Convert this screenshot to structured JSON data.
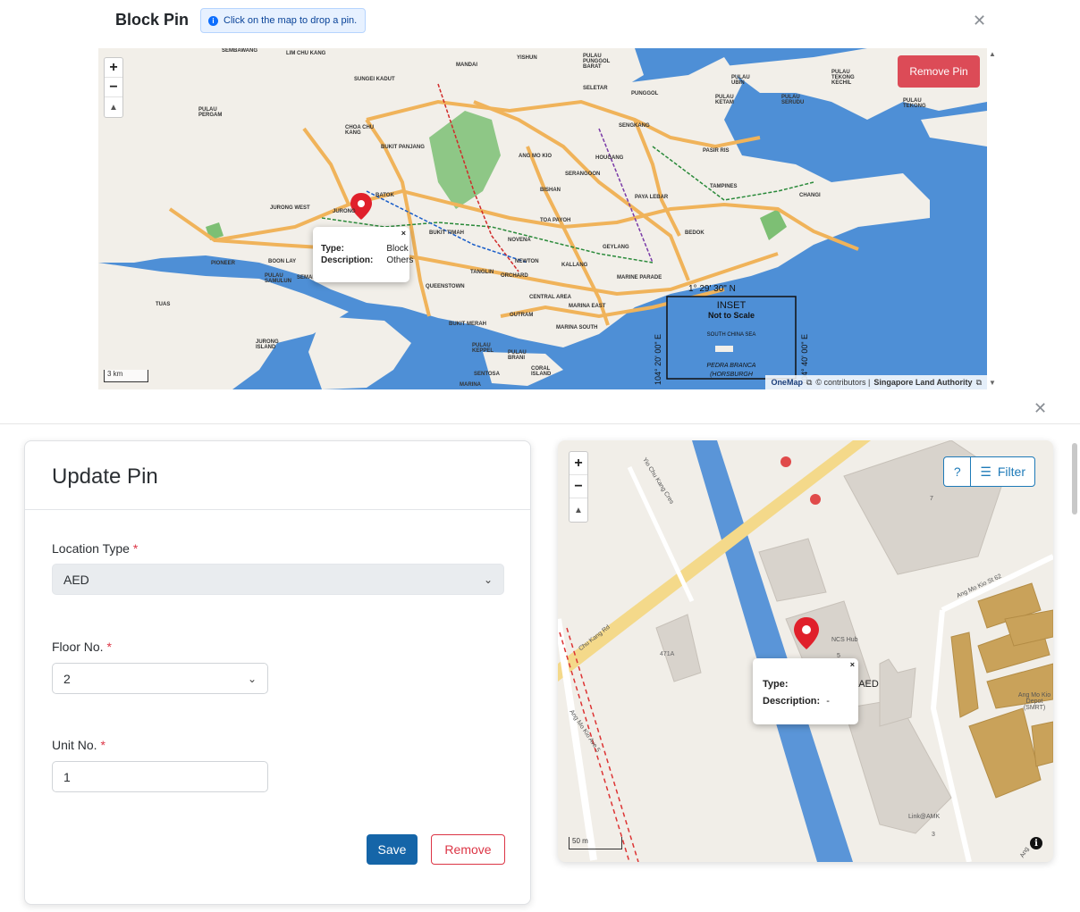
{
  "block_pin_modal": {
    "title": "Block Pin",
    "info_message": "Click on the map to drop a pin.",
    "remove_pin_label": "Remove Pin",
    "popup": {
      "type_label": "Type:",
      "type_value": "Block",
      "description_label": "Description:",
      "description_value": "Others"
    },
    "scale_label": "3 km",
    "attribution": {
      "brand": "OneMap",
      "contributors": "© contributors |",
      "authority": "Singapore Land Authority"
    },
    "inset": {
      "lat": "1° 29' 30\" N",
      "title": "INSET",
      "subtitle": "Not to Scale",
      "sea": "SOUTH CHINA SEA",
      "island": "PEDRA BRANCA",
      "island_sub": "(HORSBURGH",
      "lon_left": "104° 20' 00\" E",
      "lon_right": "104° 40' 00\" E"
    },
    "place_labels": [
      "SEMBAWANG",
      "LIM CHU KANG",
      "MANDAI",
      "YISHUN",
      "PULAU PUNGGOL BARAT",
      "SELETAR",
      "PUNGGOL",
      "PULAU UBIN",
      "PULAU TEKONG KECHIL",
      "PULAU TEKONG",
      "SUNGEI KADUT",
      "PULAU PERGAM",
      "CHOA CHU KANG",
      "BUKIT PANJANG",
      "SENGKANG",
      "PASIR RIS",
      "ANG MO KIO",
      "HOUGANG",
      "SERANGOON",
      "BISHAN",
      "PAYA LEBAR",
      "TAMPINES",
      "CHANGI",
      "JURONG WEST",
      "JURONG",
      "BATOK",
      "TOA PAYOH",
      "BUKIT TIMAH",
      "NOVENA",
      "GEYLANG",
      "BEDOK",
      "PIONEER",
      "BOON LAY",
      "NEWTON",
      "KALLANG",
      "TANGLIN",
      "ORCHARD",
      "MARINE PARADE",
      "QUEENSTOWN",
      "CENTRAL AREA",
      "TUAS",
      "MARINA EAST",
      "OUTRAM",
      "BUKIT MERAH",
      "MARINA SOUTH",
      "JURONG ISLAND",
      "PULAU KEPPEL",
      "PULAU BRANI",
      "SENTOSA",
      "CORAL ISLAND",
      "PULAU SAMULUN",
      "SEMAKAU",
      "PULAU KETAM",
      "PULAU SERUDU",
      "MARINA"
    ]
  },
  "update_pin": {
    "title": "Update Pin",
    "location_type": {
      "label": "Location Type",
      "value": "AED"
    },
    "floor_no": {
      "label": "Floor No.",
      "value": "2"
    },
    "unit_no": {
      "label": "Unit No.",
      "value": "1"
    },
    "required_marker": "*",
    "save_label": "Save",
    "remove_label": "Remove"
  },
  "detail_map": {
    "help_label": "?",
    "filter_label": "Filter",
    "popup": {
      "type_label": "Type:",
      "type_value": "AED",
      "description_label": "Description:",
      "description_value": "-"
    },
    "scale_label": "50 m",
    "labels": {
      "road1": "Yio Chu Kang Cres",
      "road2": "Chu Kang Rd",
      "road3": "Ang Mo Kio St 62",
      "road4": "Ang Mo Kio Ave 5",
      "block": "471A",
      "hub": "NCS Hub",
      "hub_no": "5",
      "depot": "Ang Mo Kio Depot (SMRT)",
      "link": "Link@AMK",
      "link_no": "3",
      "no7": "7",
      "road5": "Ang"
    }
  },
  "colors": {
    "sea": "#4e8fd6",
    "land": "#f2efe9",
    "expressway": "#f0b35a",
    "park": "#7dbf74",
    "save": "#1565a8",
    "danger": "#dc3545",
    "pin": "#e0202b"
  }
}
